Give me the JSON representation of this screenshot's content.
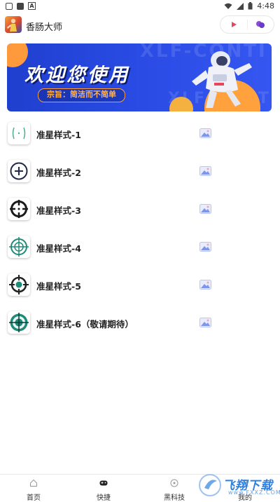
{
  "status_bar": {
    "time": "4:48"
  },
  "app": {
    "title": "香肠大师"
  },
  "banner": {
    "headline": "欢迎您使用",
    "subtitle": "宗旨：简洁而不简单",
    "ghost_text": "XLF-CONTI"
  },
  "list": {
    "items": [
      {
        "label": "准星样式-1"
      },
      {
        "label": "准星样式-2"
      },
      {
        "label": "准星样式-3"
      },
      {
        "label": "准星样式-4"
      },
      {
        "label": "准星样式-5"
      },
      {
        "label": "准星样式-6（敬请期待）"
      }
    ]
  },
  "bottom_nav": {
    "tabs": [
      {
        "label": "首页"
      },
      {
        "label": "快捷"
      },
      {
        "label": "黑科技"
      },
      {
        "label": "我的"
      }
    ]
  },
  "watermark": {
    "text": "飞翔下载",
    "url": "www.FXXZ.COM"
  },
  "colors": {
    "banner_blue": "#2b4de6",
    "accent_orange": "#ff9c3a",
    "crosshair_teal": "#1f8a78"
  }
}
